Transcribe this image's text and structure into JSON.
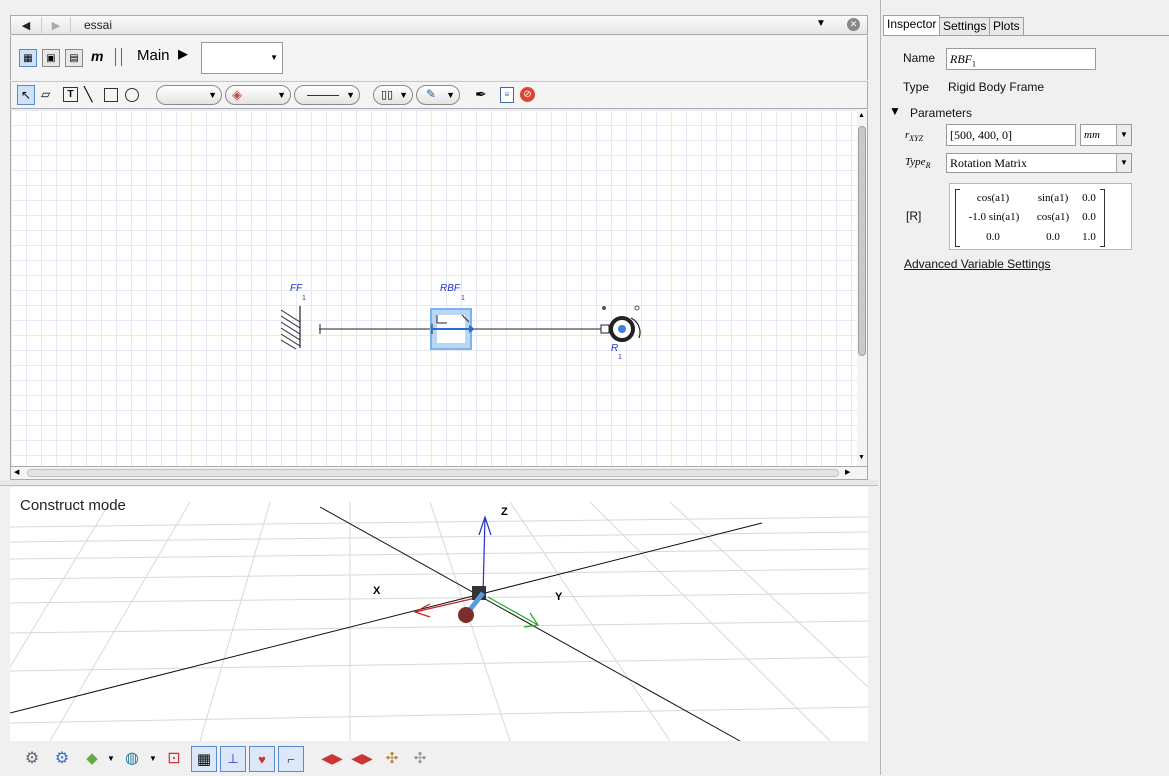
{
  "window": {
    "title": "essai"
  },
  "toolbar1": {
    "main_label": "Main"
  },
  "canvas": {
    "components": [
      {
        "name": "FF",
        "index": "1"
      },
      {
        "name": "RBF",
        "index": "1"
      },
      {
        "name": "R",
        "index": "1"
      }
    ]
  },
  "view3d": {
    "mode_label": "Construct mode",
    "axes": {
      "x": "X",
      "y": "Y",
      "z": "Z"
    }
  },
  "tabs": [
    "Inspector",
    "Settings",
    "Plots"
  ],
  "inspector": {
    "name_label": "Name",
    "name_value": "RBF",
    "name_subscript": "1",
    "type_label": "Type",
    "type_value": "Rigid Body Frame",
    "parameters_label": "Parameters",
    "r_label": "r",
    "r_subscript": "XYZ",
    "r_value": "[500, 400, 0]",
    "r_unit": "mm",
    "typeR_label": "Type",
    "typeR_subscript": "R",
    "typeR_value": "Rotation Matrix",
    "matrix_label": "[R]",
    "matrix": [
      [
        "cos(a1)",
        "sin(a1)",
        "0.0"
      ],
      [
        "-1.0 sin(a1)",
        "cos(a1)",
        "0.0"
      ],
      [
        "0.0",
        "0.0",
        "1.0"
      ]
    ],
    "advanced_link": "Advanced Variable Settings"
  }
}
